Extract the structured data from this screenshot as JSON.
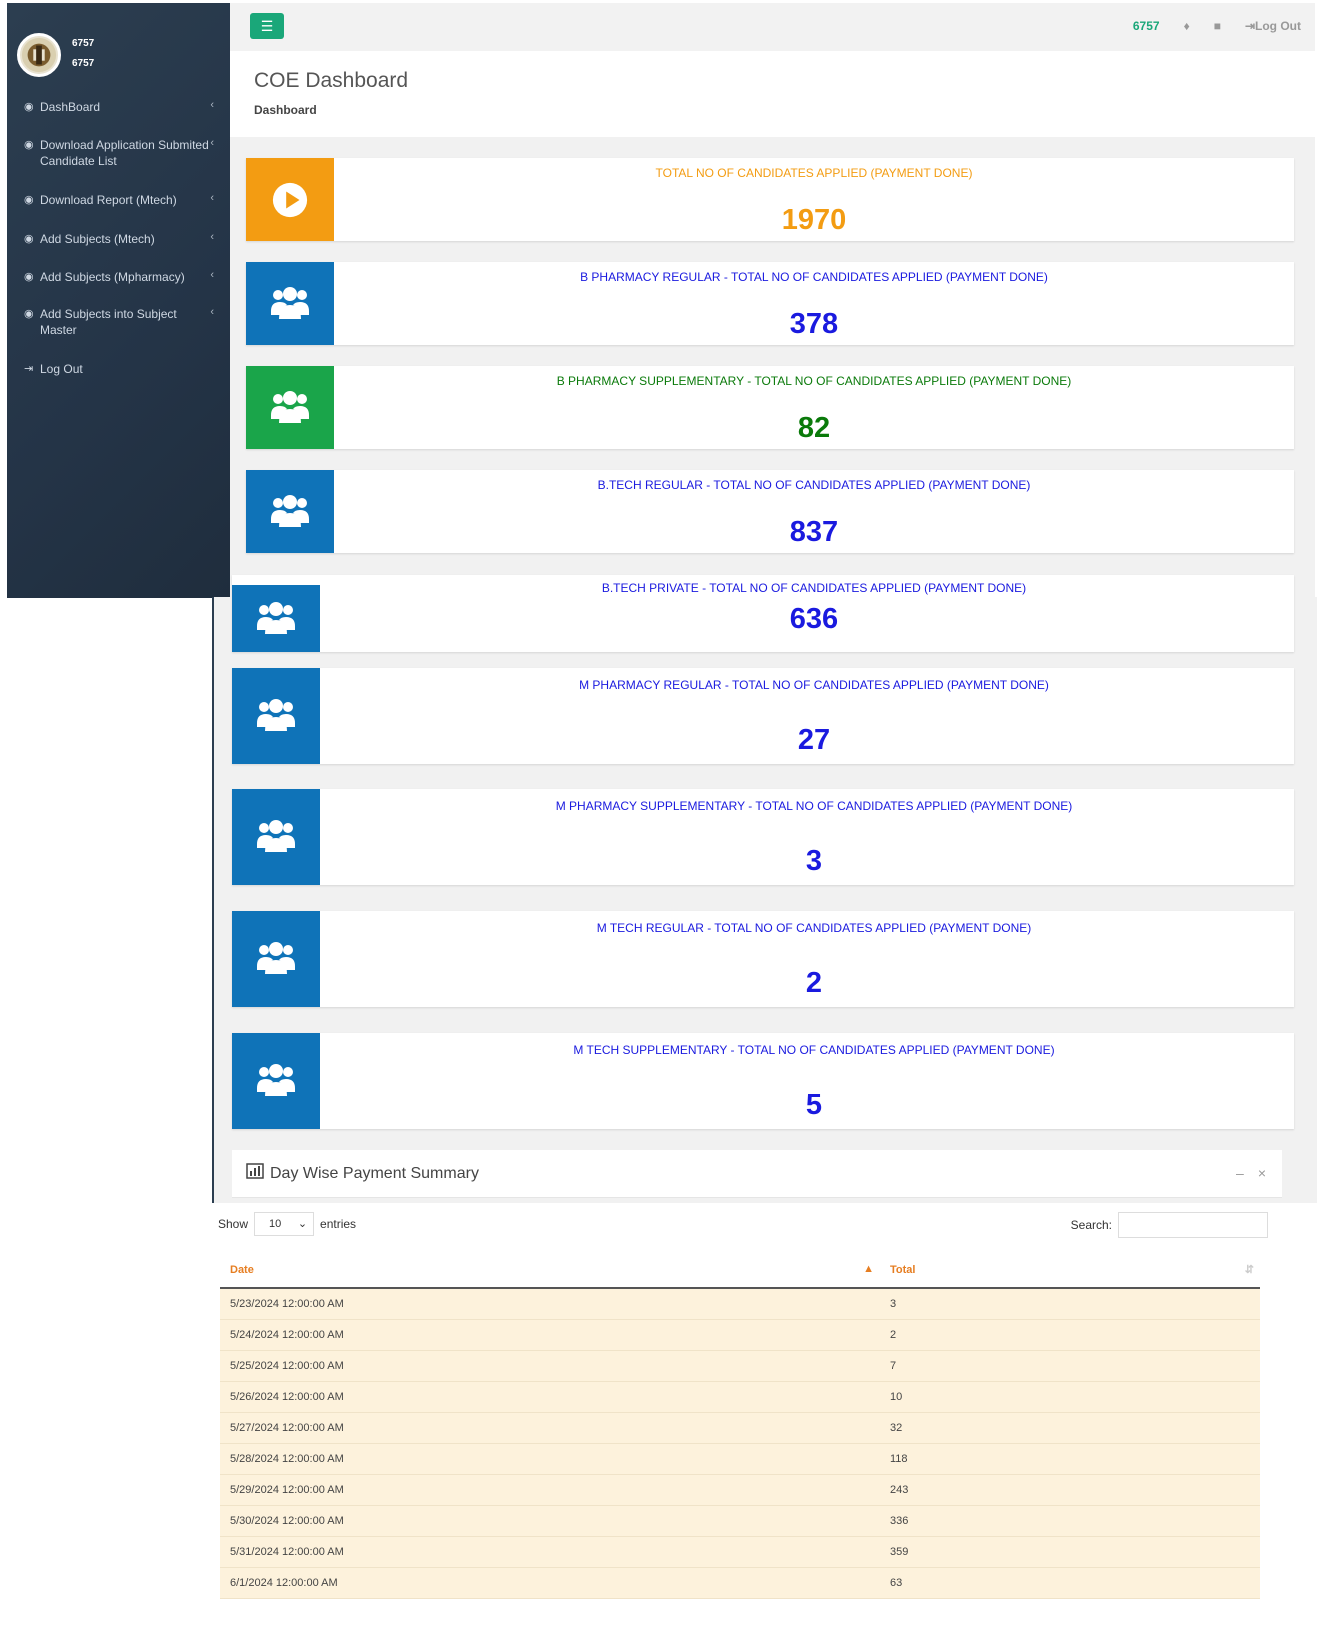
{
  "sidebar": {
    "user_line1": "6757",
    "user_line2": "6757",
    "items": [
      {
        "label": "DashBoard",
        "icon": "dashboard-icon"
      },
      {
        "label": "Download Application Submited Candidate List",
        "icon": "dashboard-icon"
      },
      {
        "label": "Download Report (Mtech)",
        "icon": "dashboard-icon"
      },
      {
        "label": "Add Subjects (Mtech)",
        "icon": "dashboard-icon"
      },
      {
        "label": "Add Subjects (Mpharmacy)",
        "icon": "dashboard-icon"
      },
      {
        "label": "Add Subjects into Subject Master",
        "icon": "dashboard-icon"
      },
      {
        "label": "Log Out",
        "icon": "sign-out-icon"
      }
    ]
  },
  "topbar": {
    "user_id": "6757",
    "logout_label": "Log Out"
  },
  "header": {
    "title": "COE Dashboard",
    "breadcrumb": "Dashboard"
  },
  "cards": [
    {
      "title": "TOTAL NO OF CANDIDATES APPLIED (PAYMENT DONE)",
      "value": "1970",
      "color": "#f39c12",
      "box_color": "#f39c12",
      "icon": "play-circle-icon"
    },
    {
      "title": "B PHARMACY REGULAR - TOTAL NO OF CANDIDATES APPLIED (PAYMENT DONE)",
      "value": "378",
      "color": "#1a1adf",
      "box_color": "#0f73b8",
      "icon": "users-icon"
    },
    {
      "title": "B PHARMACY SUPPLEMENTARY - TOTAL NO OF CANDIDATES APPLIED (PAYMENT DONE)",
      "value": "82",
      "color": "#0a7a0a",
      "box_color": "#1aa54a",
      "icon": "users-icon"
    },
    {
      "title": "B.TECH REGULAR - TOTAL NO OF CANDIDATES APPLIED (PAYMENT DONE)",
      "value": "837",
      "color": "#1a1adf",
      "box_color": "#0f73b8",
      "icon": "users-icon"
    },
    {
      "title": "B.TECH PRIVATE - TOTAL NO OF CANDIDATES APPLIED (PAYMENT DONE)",
      "value": "636",
      "color": "#1a1adf",
      "box_color": "#0f73b8",
      "icon": "users-icon"
    },
    {
      "title": "M PHARMACY REGULAR - TOTAL NO OF CANDIDATES APPLIED (PAYMENT DONE)",
      "value": "27",
      "color": "#1a1adf",
      "box_color": "#0f73b8",
      "icon": "users-icon"
    },
    {
      "title": "M PHARMACY SUPPLEMENTARY - TOTAL NO OF CANDIDATES APPLIED (PAYMENT DONE)",
      "value": "3",
      "color": "#1a1adf",
      "box_color": "#0f73b8",
      "icon": "users-icon"
    },
    {
      "title": "M TECH REGULAR - TOTAL NO OF CANDIDATES APPLIED (PAYMENT DONE)",
      "value": "2",
      "color": "#1a1adf",
      "box_color": "#0f73b8",
      "icon": "users-icon"
    },
    {
      "title": "M TECH SUPPLEMENTARY - TOTAL NO OF CANDIDATES APPLIED (PAYMENT DONE)",
      "value": "5",
      "color": "#1a1adf",
      "box_color": "#0f73b8",
      "icon": "users-icon"
    }
  ],
  "summary": {
    "title": "Day Wise Payment Summary",
    "show_label": "Show",
    "entries_value": "10",
    "entries_label": "entries",
    "search_label": "Search:",
    "columns": [
      "Date",
      "Total"
    ],
    "rows": [
      [
        "5/23/2024 12:00:00 AM",
        "3"
      ],
      [
        "5/24/2024 12:00:00 AM",
        "2"
      ],
      [
        "5/25/2024 12:00:00 AM",
        "7"
      ],
      [
        "5/26/2024 12:00:00 AM",
        "10"
      ],
      [
        "5/27/2024 12:00:00 AM",
        "32"
      ],
      [
        "5/28/2024 12:00:00 AM",
        "118"
      ],
      [
        "5/29/2024 12:00:00 AM",
        "243"
      ],
      [
        "5/30/2024 12:00:00 AM",
        "336"
      ],
      [
        "5/31/2024 12:00:00 AM",
        "359"
      ],
      [
        "6/1/2024 12:00:00 AM",
        "63"
      ]
    ]
  }
}
